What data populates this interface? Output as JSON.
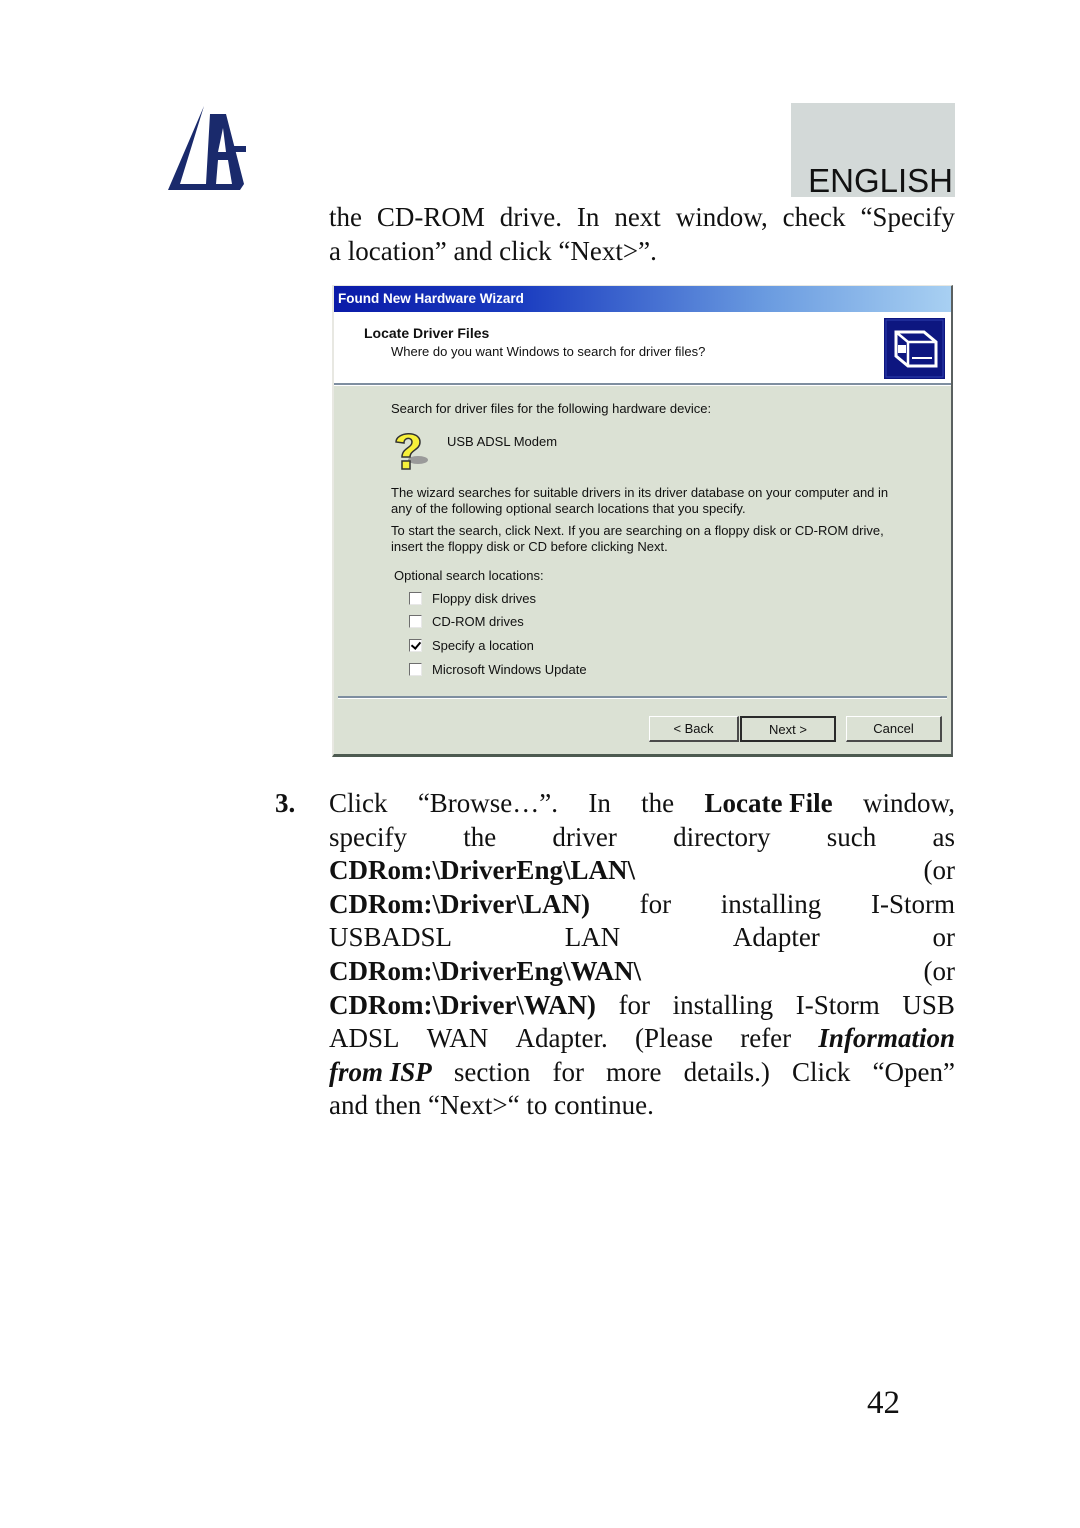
{
  "header": {
    "logo": "atlantis-sailboat-logo",
    "language_label": "ENGLISH",
    "colors": {
      "logo": "#1a2a6c",
      "language_box": "#d3d9d8"
    }
  },
  "intro": {
    "line1": [
      "the",
      "CD-ROM",
      "drive.",
      "In",
      "next",
      "window,",
      "check",
      "“Specify"
    ],
    "line2": "a location” and click “Next>”."
  },
  "dialog": {
    "title": "Found New Hardware Wizard",
    "header_title": "Locate Driver Files",
    "header_subtitle": "Where do you want Windows to search for driver files?",
    "header_icon": "hardware-wizard-icon",
    "search_label": "Search for driver files for the following hardware device:",
    "device_icon": "unknown-device-question-icon",
    "device_name": "USB ADSL Modem",
    "para1_line1": "The wizard searches for suitable drivers in its driver database on your computer and in",
    "para1_line2": "any of the following optional search locations that you specify.",
    "para2_line1": "To start the search, click Next. If you are searching on a floppy disk or CD-ROM drive,",
    "para2_line2": "insert the floppy disk or CD before clicking Next.",
    "optional_label": "Optional search locations:",
    "options": [
      {
        "label": "Floppy disk drives",
        "checked": false
      },
      {
        "label": "CD-ROM drives",
        "checked": false
      },
      {
        "label": "Specify a location",
        "checked": true
      },
      {
        "label": "Microsoft Windows Update",
        "checked": false
      }
    ],
    "buttons": {
      "back": "< Back",
      "next": "Next >",
      "cancel": "Cancel"
    },
    "colors": {
      "titlebar_start": "#0a1aa8",
      "titlebar_end": "#a8d0f2",
      "face": "#dbe1d4"
    }
  },
  "step3": {
    "number": "3.",
    "l1": [
      "Click",
      "“Browse…”.",
      "In",
      "the",
      "Locate File",
      "window,"
    ],
    "l2": [
      "specify",
      "the",
      "driver",
      "directory",
      "such",
      "as"
    ],
    "l3": [
      "CDRom:\\DriverEng\\LAN\\",
      "(or"
    ],
    "l4": [
      "CDRom:\\Driver\\LAN)",
      "for",
      "installing",
      "I-Storm"
    ],
    "l5": [
      "USBADSL",
      "LAN",
      "Adapter",
      "or"
    ],
    "l6": [
      "CDRom:\\DriverEng\\WAN\\",
      "(or"
    ],
    "l7": [
      "CDRom:\\Driver\\WAN)",
      "for",
      "installing",
      "I-Storm",
      "USB"
    ],
    "l8": [
      "ADSL",
      "WAN",
      "Adapter.",
      "(Please",
      "refer",
      "Information"
    ],
    "l9": [
      "from ISP",
      "section",
      "for",
      "more",
      "details.)",
      "Click",
      "“Open”"
    ],
    "l10": "and then “Next>“ to continue."
  },
  "page_number": "42"
}
